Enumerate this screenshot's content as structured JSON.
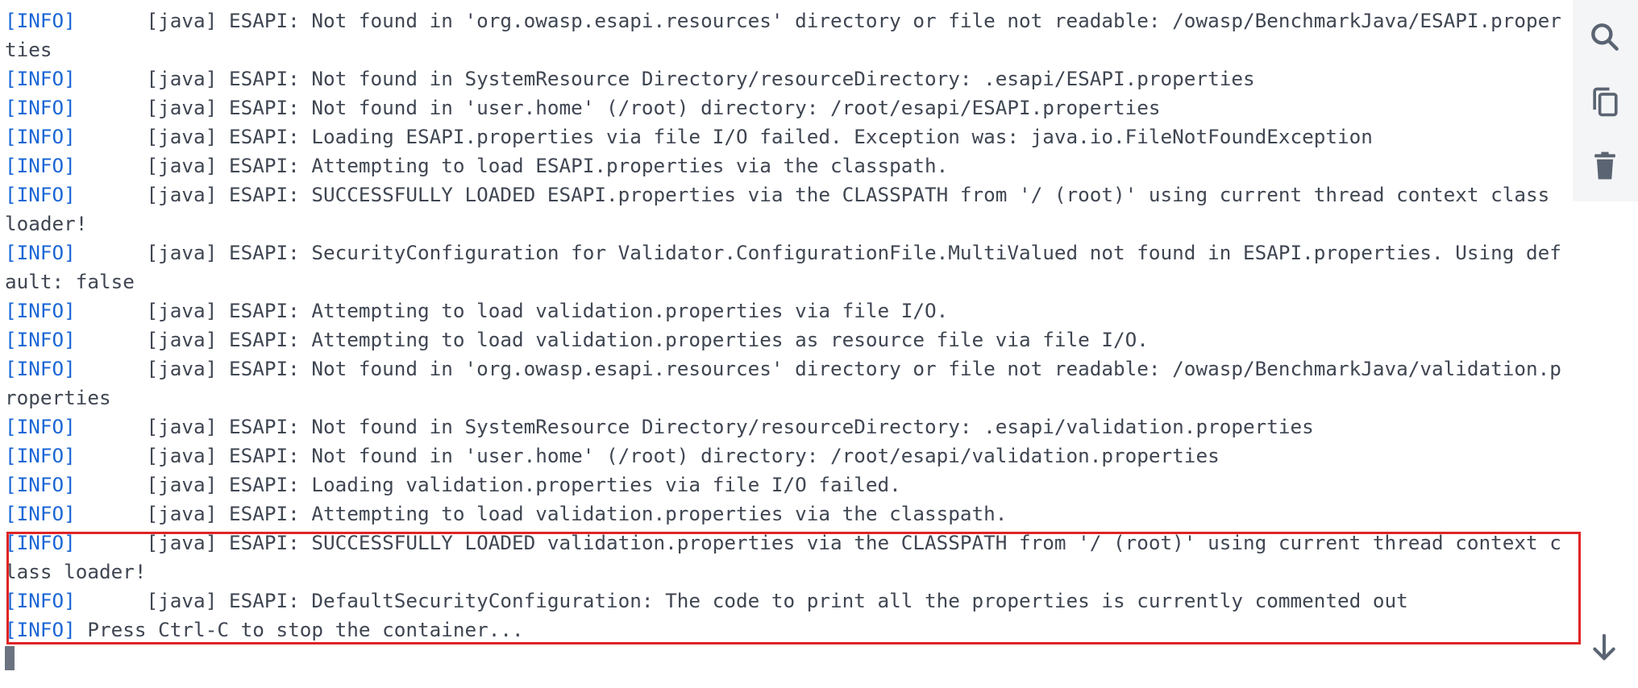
{
  "terminal": {
    "lines": [
      {
        "tag": "[INFO]",
        "text": "      [java] ESAPI: Not found in 'org.owasp.esapi.resources' directory or file not readable: /owasp/BenchmarkJava/ESAPI.properties"
      },
      {
        "tag": "[INFO]",
        "text": "      [java] ESAPI: Not found in SystemResource Directory/resourceDirectory: .esapi/ESAPI.properties"
      },
      {
        "tag": "[INFO]",
        "text": "      [java] ESAPI: Not found in 'user.home' (/root) directory: /root/esapi/ESAPI.properties"
      },
      {
        "tag": "[INFO]",
        "text": "      [java] ESAPI: Loading ESAPI.properties via file I/O failed. Exception was: java.io.FileNotFoundException"
      },
      {
        "tag": "[INFO]",
        "text": "      [java] ESAPI: Attempting to load ESAPI.properties via the classpath."
      },
      {
        "tag": "[INFO]",
        "text": "      [java] ESAPI: SUCCESSFULLY LOADED ESAPI.properties via the CLASSPATH from '/ (root)' using current thread context class loader!"
      },
      {
        "tag": "[INFO]",
        "text": "      [java] ESAPI: SecurityConfiguration for Validator.ConfigurationFile.MultiValued not found in ESAPI.properties. Using default: false"
      },
      {
        "tag": "[INFO]",
        "text": "      [java] ESAPI: Attempting to load validation.properties via file I/O."
      },
      {
        "tag": "[INFO]",
        "text": "      [java] ESAPI: Attempting to load validation.properties as resource file via file I/O."
      },
      {
        "tag": "[INFO]",
        "text": "      [java] ESAPI: Not found in 'org.owasp.esapi.resources' directory or file not readable: /owasp/BenchmarkJava/validation.properties"
      },
      {
        "tag": "[INFO]",
        "text": "      [java] ESAPI: Not found in SystemResource Directory/resourceDirectory: .esapi/validation.properties"
      },
      {
        "tag": "[INFO]",
        "text": "      [java] ESAPI: Not found in 'user.home' (/root) directory: /root/esapi/validation.properties"
      },
      {
        "tag": "[INFO]",
        "text": "      [java] ESAPI: Loading validation.properties via file I/O failed."
      },
      {
        "tag": "[INFO]",
        "text": "      [java] ESAPI: Attempting to load validation.properties via the classpath."
      },
      {
        "tag": "[INFO]",
        "text": "      [java] ESAPI: SUCCESSFULLY LOADED validation.properties via the CLASSPATH from '/ (root)' using current thread context class loader!"
      },
      {
        "tag": "[INFO]",
        "text": "      [java] ESAPI: DefaultSecurityConfiguration: The code to print all the properties is currently commented out"
      },
      {
        "tag": "[INFO]",
        "text": " Press Ctrl-C to stop the container..."
      }
    ]
  },
  "toolbar": {
    "search_icon": "search-icon",
    "copy_icon": "copy-icon",
    "delete_icon": "trash-icon"
  },
  "scroll_icon": "arrow-down-icon",
  "colors": {
    "text": "#3f4652",
    "tag": "#1a66d6",
    "highlight": "#e02424",
    "toolbar_bg": "#f4f5f7"
  }
}
